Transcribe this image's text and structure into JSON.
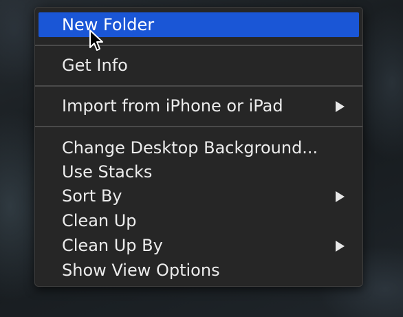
{
  "context_menu": {
    "items": [
      {
        "label": "New Folder",
        "highlighted": true,
        "submenu": false
      },
      {
        "label": "Get Info",
        "highlighted": false,
        "submenu": false
      },
      {
        "label": "Import from iPhone or iPad",
        "highlighted": false,
        "submenu": true
      },
      {
        "label": "Change Desktop Background...",
        "highlighted": false,
        "submenu": false
      },
      {
        "label": "Use Stacks",
        "highlighted": false,
        "submenu": false
      },
      {
        "label": "Sort By",
        "highlighted": false,
        "submenu": true
      },
      {
        "label": "Clean Up",
        "highlighted": false,
        "submenu": false
      },
      {
        "label": "Clean Up By",
        "highlighted": false,
        "submenu": true
      },
      {
        "label": "Show View Options",
        "highlighted": false,
        "submenu": false
      }
    ]
  },
  "icons": {
    "submenu_arrow": "chevron-right-icon",
    "pointer": "mouse-pointer-icon"
  },
  "colors": {
    "highlight": "#1a56d6",
    "menu_background": "#262626",
    "text": "#ececec"
  }
}
